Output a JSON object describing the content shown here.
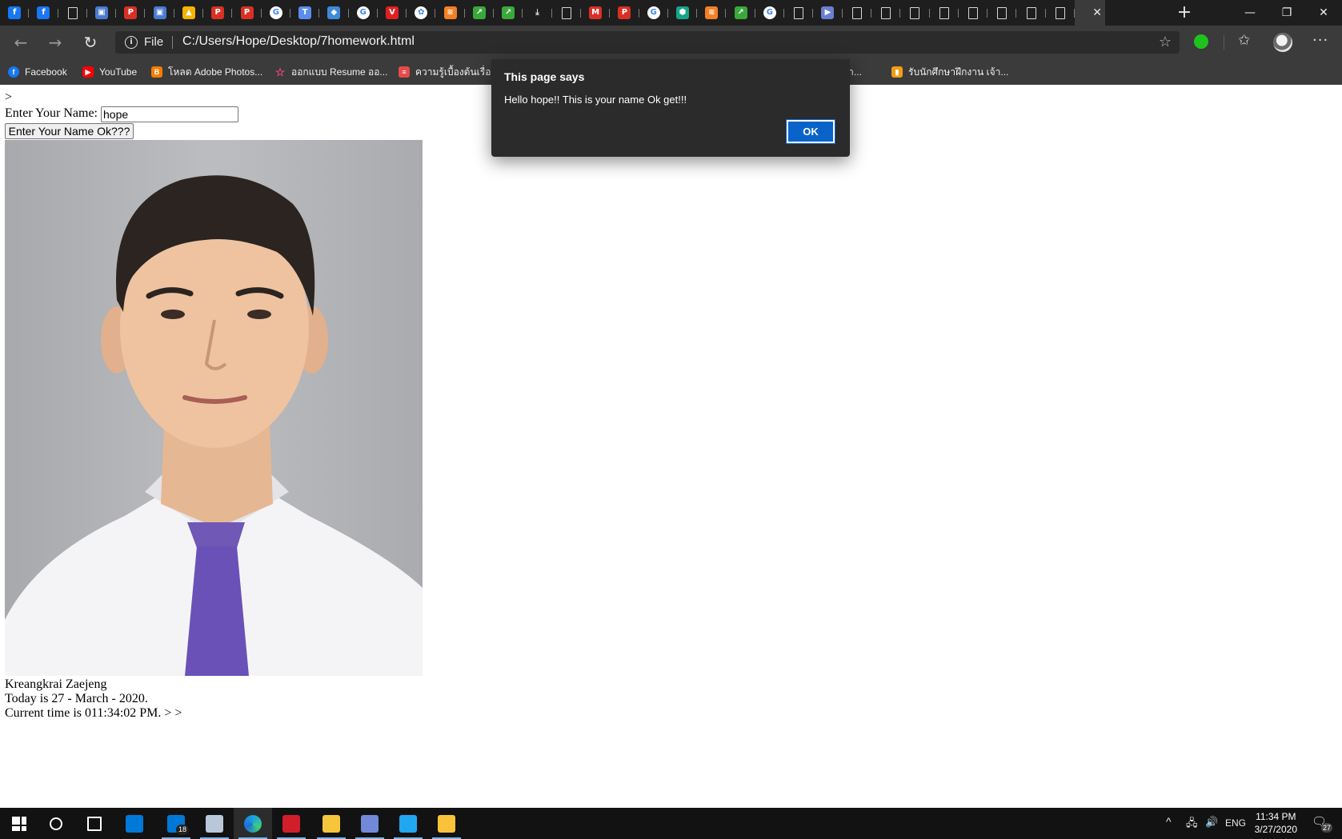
{
  "browser": {
    "active_tab_close": "✕",
    "new_tab": "+",
    "window_controls": {
      "minimize": "—",
      "restore": "❐",
      "close": "✕"
    },
    "scheme_label": "File",
    "url": "C:/Users/Hope/Desktop/7homework.html"
  },
  "tabs": [
    {
      "icon": "facebook",
      "color": "#1877f2",
      "glyph": "f"
    },
    {
      "icon": "facebook",
      "color": "#1877f2",
      "glyph": "f"
    },
    {
      "icon": "document",
      "color": "",
      "glyph": ""
    },
    {
      "icon": "contacts",
      "color": "#4a7bd0",
      "glyph": "▣"
    },
    {
      "icon": "pdf",
      "color": "#d93025",
      "glyph": "P"
    },
    {
      "icon": "contacts",
      "color": "#4a7bd0",
      "glyph": "▣"
    },
    {
      "icon": "google-drive",
      "color": "#f4b400",
      "glyph": "▲"
    },
    {
      "icon": "pdf",
      "color": "#d93025",
      "glyph": "P"
    },
    {
      "icon": "pdf",
      "color": "#d93025",
      "glyph": "P"
    },
    {
      "icon": "google",
      "color": "#ffffff",
      "glyph": "G"
    },
    {
      "icon": "translate",
      "color": "#5b8def",
      "glyph": "T"
    },
    {
      "icon": "app",
      "color": "#3d8bd9",
      "glyph": "◆"
    },
    {
      "icon": "google",
      "color": "#ffffff",
      "glyph": "G"
    },
    {
      "icon": "vivaldi",
      "color": "#e02020",
      "glyph": "V"
    },
    {
      "icon": "openai",
      "color": "#ffffff",
      "glyph": "✿"
    },
    {
      "icon": "stackoverflow",
      "color": "#f48024",
      "glyph": "≋"
    },
    {
      "icon": "chart",
      "color": "#3aa83a",
      "glyph": "↗"
    },
    {
      "icon": "chart",
      "color": "#3aa83a",
      "glyph": "↗"
    },
    {
      "icon": "download",
      "color": "",
      "glyph": "⤓"
    },
    {
      "icon": "document",
      "color": "",
      "glyph": ""
    },
    {
      "icon": "gmail",
      "color": "#d93025",
      "glyph": "M"
    },
    {
      "icon": "pdf",
      "color": "#d93025",
      "glyph": "P"
    },
    {
      "icon": "google",
      "color": "#ffffff",
      "glyph": "G"
    },
    {
      "icon": "shield",
      "color": "#17a589",
      "glyph": "⬢"
    },
    {
      "icon": "stackoverflow",
      "color": "#f48024",
      "glyph": "≋"
    },
    {
      "icon": "chart",
      "color": "#3aa83a",
      "glyph": "↗"
    },
    {
      "icon": "google",
      "color": "#ffffff",
      "glyph": "G"
    },
    {
      "icon": "document",
      "color": "",
      "glyph": ""
    },
    {
      "icon": "media",
      "color": "#6a7fd0",
      "glyph": "▶"
    },
    {
      "icon": "document",
      "color": "",
      "glyph": ""
    },
    {
      "icon": "document",
      "color": "",
      "glyph": ""
    },
    {
      "icon": "document",
      "color": "",
      "glyph": ""
    },
    {
      "icon": "document",
      "color": "",
      "glyph": ""
    },
    {
      "icon": "document",
      "color": "",
      "glyph": ""
    },
    {
      "icon": "document",
      "color": "",
      "glyph": ""
    },
    {
      "icon": "document",
      "color": "",
      "glyph": ""
    },
    {
      "icon": "document",
      "color": "",
      "glyph": ""
    }
  ],
  "bookmarks": [
    {
      "label": "Facebook",
      "icon": "facebook",
      "color": "#1877f2",
      "glyph": "f"
    },
    {
      "label": "YouTube",
      "icon": "youtube",
      "color": "#ff0000",
      "glyph": "▶"
    },
    {
      "label": "โหลด Adobe Photos...",
      "icon": "blogger",
      "color": "#f57d00",
      "glyph": "B"
    },
    {
      "label": "ออกแบบ Resume ออ...",
      "icon": "star",
      "color": "#e0457b",
      "glyph": "☆"
    },
    {
      "label": "ความรู้เบื้องต้นเรื่องกา",
      "icon": "site",
      "color": "#e84a4a",
      "glyph": "≡"
    },
    {
      "label": "ฝึกงา...",
      "icon": "",
      "color": "",
      "glyph": ""
    },
    {
      "label": "รับนักศึกษาฝึกงาน เจ้า...",
      "icon": "bookmark",
      "color": "#f39c12",
      "glyph": "▮"
    }
  ],
  "page": {
    "stray_text": ">",
    "name_label": "Enter Your Name:",
    "name_value": "hope",
    "submit_label": "Enter Your Name Ok???",
    "owner_name": "Kreangkrai Zaejeng",
    "today_text": "Today is 27 - March - 2020.",
    "clock_text": "Current time is 011:34:02 PM. > >"
  },
  "dialog": {
    "title": "This page says",
    "message": "Hello hope!! This is your name Ok get!!!",
    "ok_label": "OK"
  },
  "taskbar": {
    "apps": [
      {
        "name": "start",
        "color": "#ffffff"
      },
      {
        "name": "search",
        "color": "#ffffff"
      },
      {
        "name": "task-view",
        "color": "#ffffff"
      },
      {
        "name": "store",
        "color": "#0078d7"
      },
      {
        "name": "mail",
        "color": "#0078d7",
        "badge": "18"
      },
      {
        "name": "notepad",
        "color": "#b9c7d8"
      },
      {
        "name": "edge",
        "color": "#1ba1e2"
      },
      {
        "name": "game-app",
        "color": "#d01f2a"
      },
      {
        "name": "python-idle",
        "color": "#f6c53b"
      },
      {
        "name": "discord-app",
        "color": "#7289da"
      },
      {
        "name": "vscode",
        "color": "#22a6f2"
      },
      {
        "name": "file-explorer",
        "color": "#f8c33a"
      }
    ],
    "tray": {
      "language": "ENG",
      "time": "11:34 PM",
      "date": "3/27/2020",
      "notifications": "27"
    }
  }
}
